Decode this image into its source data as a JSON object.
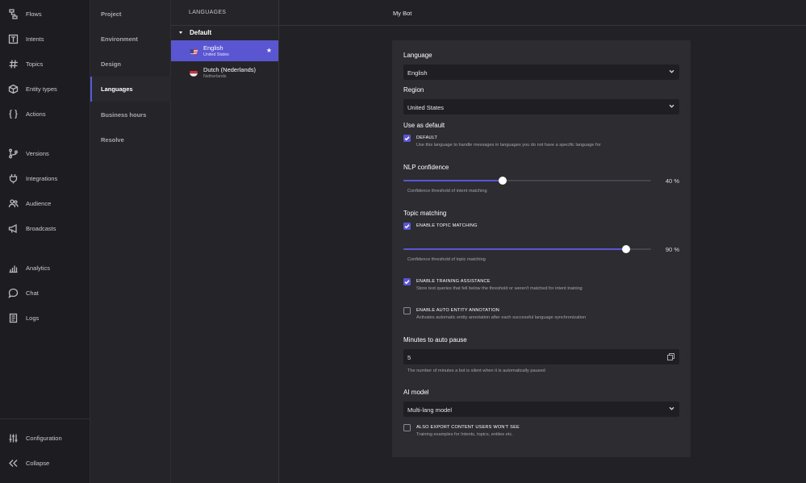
{
  "nav": {
    "items": [
      {
        "label": "Flows",
        "icon": "flows-icon"
      },
      {
        "label": "Intents",
        "icon": "intents-icon"
      },
      {
        "label": "Topics",
        "icon": "hash-icon"
      },
      {
        "label": "Entity types",
        "icon": "cube-icon"
      },
      {
        "label": "Actions",
        "icon": "braces-icon"
      },
      {
        "label": "Versions",
        "icon": "branch-icon"
      },
      {
        "label": "Integrations",
        "icon": "plug-icon"
      },
      {
        "label": "Audience",
        "icon": "users-icon"
      },
      {
        "label": "Broadcasts",
        "icon": "megaphone-icon"
      },
      {
        "label": "Analytics",
        "icon": "bar-chart-icon"
      },
      {
        "label": "Chat",
        "icon": "chat-icon"
      },
      {
        "label": "Logs",
        "icon": "document-icon"
      }
    ],
    "configuration": "Configuration",
    "collapse": "Collapse"
  },
  "settings": {
    "items": [
      "Project",
      "Environment",
      "Design",
      "Languages",
      "Business hours",
      "Resolve"
    ],
    "active": "Languages"
  },
  "languages": {
    "header": "LANGUAGES",
    "group": "Default",
    "items": [
      {
        "name": "English",
        "region": "United States",
        "flag": "us",
        "starred": true,
        "active": true
      },
      {
        "name": "Dutch (Nederlands)",
        "region": "Netherlands",
        "flag": "nl",
        "starred": false,
        "active": false
      }
    ],
    "star_glyph": "★"
  },
  "main": {
    "title": "My Bot",
    "language_label": "Language",
    "language_value": "English",
    "region_label": "Region",
    "region_value": "United States",
    "default_label": "Use as default",
    "default_cb_title": "DEFAULT",
    "default_cb_desc": "Use this language to handle messages in languages you do not have a specific language for",
    "nlp_label": "NLP confidence",
    "nlp_value": 40,
    "nlp_text": "40 %",
    "nlp_hint": "Confidence threshold of intent matching",
    "topic_label": "Topic matching",
    "topic_cb_title": "ENABLE TOPIC MATCHING",
    "topic_value": 90,
    "topic_text": "90 %",
    "topic_hint": "Confidence threshold of topic matching",
    "training_cb_title": "ENABLE TRAINING ASSISTANCE",
    "training_cb_desc": "Store text queries that fell below the threshold or weren't matched for intent training",
    "auto_cb_title": "ENABLE AUTO ENTITY ANNOTATION",
    "auto_cb_desc": "Activates automatic entity annotation after each successful language synchronization",
    "pause_label": "Minutes to auto pause",
    "pause_value": "5",
    "pause_hint": "The number of minutes a bot is silent when it is automatically paused",
    "ai_label": "AI model",
    "ai_value": "Multi-lang model",
    "export_cb_title": "ALSO EXPORT CONTENT USERS WON'T SEE",
    "export_cb_desc": "Training examples for Intents, topics, entites etc.",
    "checkboxes": {
      "default": true,
      "topic": true,
      "training": true,
      "auto": false,
      "export": false
    }
  },
  "colors": {
    "accent": "#5a56d2",
    "background": "#222226",
    "panel": "#2c2c31"
  }
}
